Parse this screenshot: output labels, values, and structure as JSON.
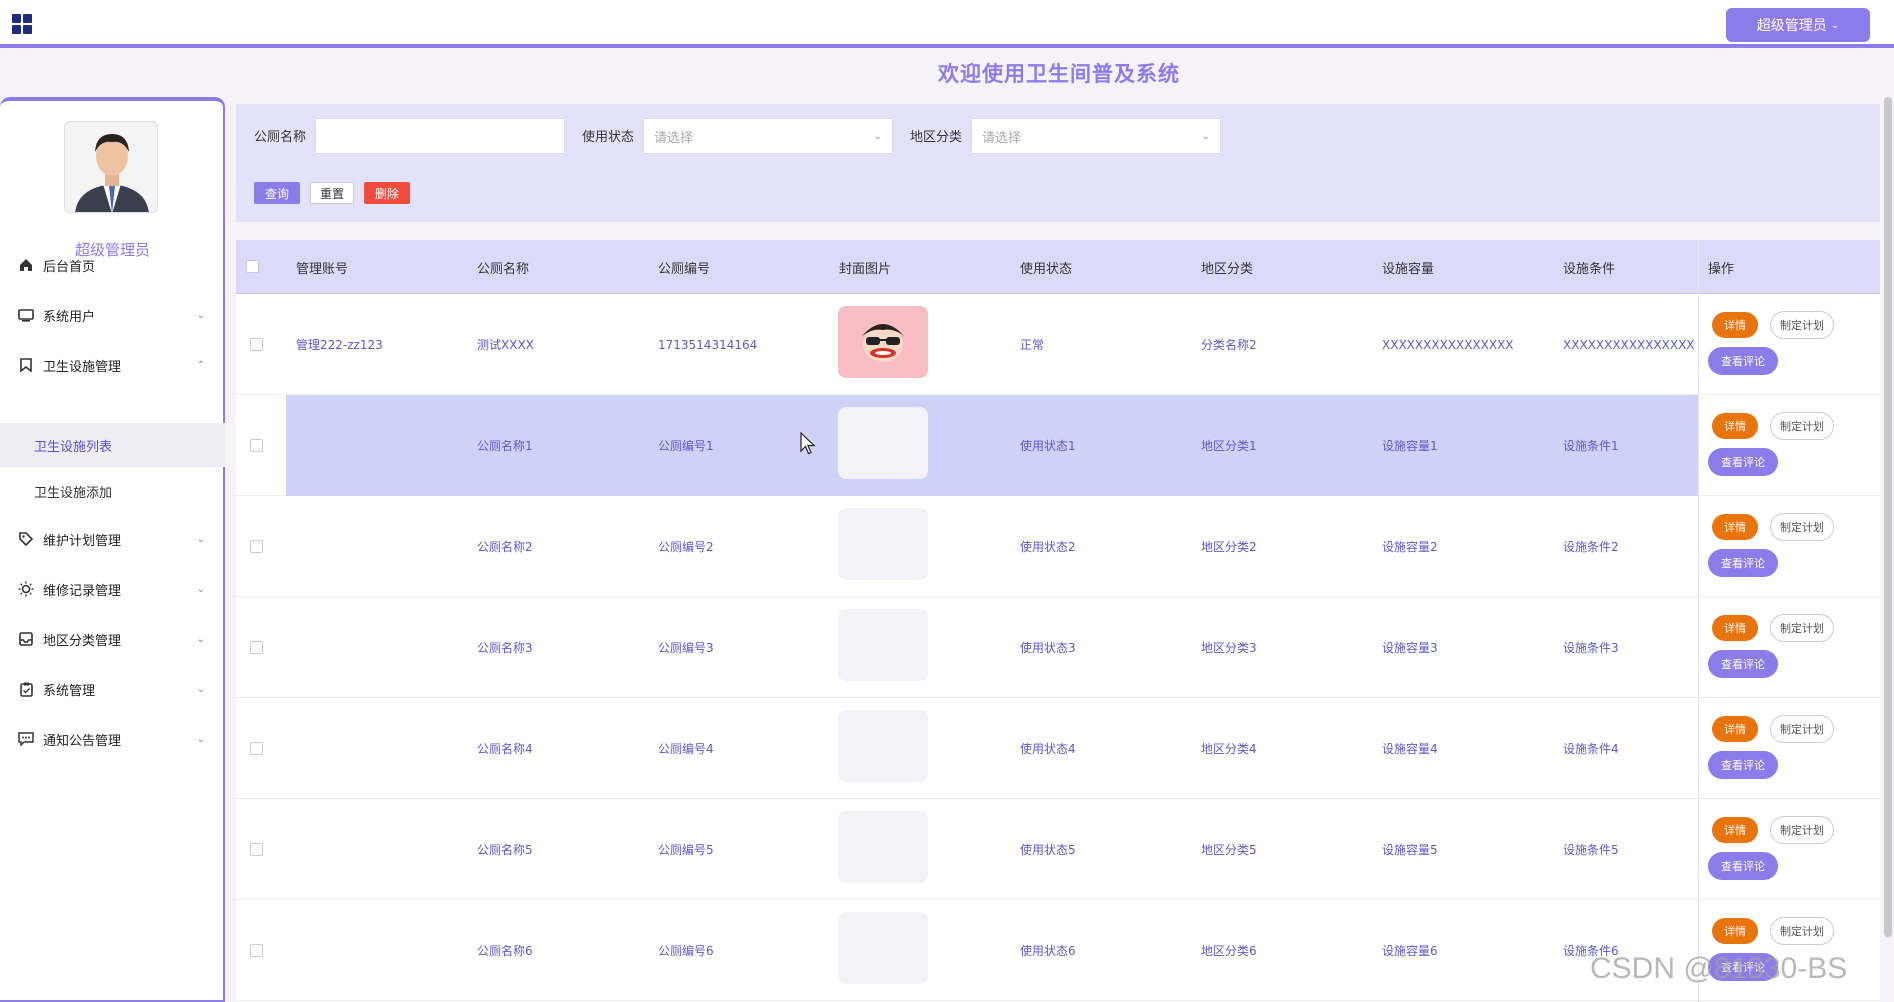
{
  "header": {
    "user_button_label": "超级管理员",
    "welcome_title": "欢迎使用卫生间普及系统"
  },
  "sidebar": {
    "username": "超级管理员",
    "items": [
      {
        "label": "后台首页",
        "icon": "home-icon"
      },
      {
        "label": "系统用户",
        "icon": "monitor-icon"
      },
      {
        "label": "卫生设施管理",
        "icon": "bookmark-icon"
      },
      {
        "label": "维护计划管理",
        "icon": "tag-icon"
      },
      {
        "label": "维修记录管理",
        "icon": "sun-icon"
      },
      {
        "label": "地区分类管理",
        "icon": "inbox-icon"
      },
      {
        "label": "系统管理",
        "icon": "clipboard-icon"
      },
      {
        "label": "通知公告管理",
        "icon": "message-icon"
      }
    ],
    "subitems": [
      {
        "label": "卫生设施列表"
      },
      {
        "label": "卫生设施添加"
      }
    ]
  },
  "search": {
    "name_label": "公厕名称",
    "name_value": "",
    "status_label": "使用状态",
    "status_placeholder": "请选择",
    "region_label": "地区分类",
    "region_placeholder": "请选择",
    "query_button": "查询",
    "reset_button": "重置",
    "delete_button": "删除"
  },
  "table": {
    "columns": [
      "管理账号",
      "公厕名称",
      "公厕编号",
      "封面图片",
      "使用状态",
      "地区分类",
      "设施容量",
      "设施条件",
      "操作"
    ],
    "rows": [
      {
        "account": "管理222-zz123",
        "name": "测试XXXX",
        "code": "1713514314164",
        "status": "正常",
        "region": "分类名称2",
        "capacity": "XXXXXXXXXXXXXXXX",
        "condition": "XXXXXXXXXXXXXXXX"
      },
      {
        "account": "",
        "name": "公厕名称1",
        "code": "公厕编号1",
        "status": "使用状态1",
        "region": "地区分类1",
        "capacity": "设施容量1",
        "condition": "设施条件1"
      },
      {
        "account": "",
        "name": "公厕名称2",
        "code": "公厕编号2",
        "status": "使用状态2",
        "region": "地区分类2",
        "capacity": "设施容量2",
        "condition": "设施条件2"
      },
      {
        "account": "",
        "name": "公厕名称3",
        "code": "公厕编号3",
        "status": "使用状态3",
        "region": "地区分类3",
        "capacity": "设施容量3",
        "condition": "设施条件3"
      },
      {
        "account": "",
        "name": "公厕名称4",
        "code": "公厕编号4",
        "status": "使用状态4",
        "region": "地区分类4",
        "capacity": "设施容量4",
        "condition": "设施条件4"
      },
      {
        "account": "",
        "name": "公厕名称5",
        "code": "公厕编号5",
        "status": "使用状态5",
        "region": "地区分类5",
        "capacity": "设施容量5",
        "condition": "设施条件5"
      },
      {
        "account": "",
        "name": "公厕名称6",
        "code": "公厕编号6",
        "status": "使用状态6",
        "region": "地区分类6",
        "capacity": "设施容量6",
        "condition": "设施条件6"
      }
    ],
    "actions": {
      "detail": "详情",
      "plan": "制定计划",
      "comments": "查看评论"
    }
  },
  "watermark": "CSDN @81330-BS",
  "colors": {
    "accent": "#8c7cea",
    "detail_button": "#e8740e",
    "delete_button": "#f04c3e",
    "panel": "#e4e1fb"
  }
}
